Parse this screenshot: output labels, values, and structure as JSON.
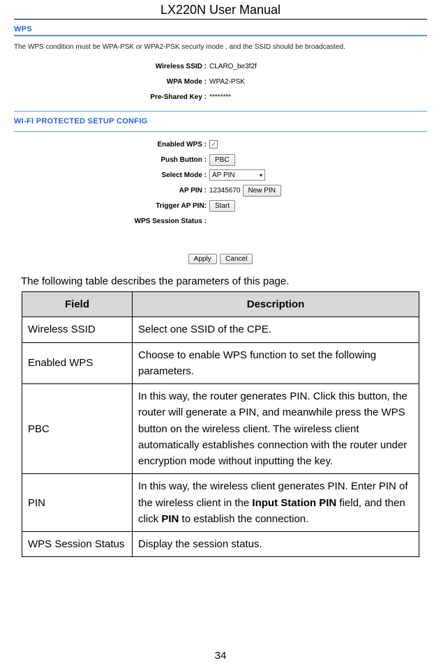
{
  "header": {
    "title": "LX220N User Manual"
  },
  "wps": {
    "section_title": "WPS",
    "condition": "The WPS condition must be WPA-PSK or WPA2-PSK securty mode , and the SSID should be broadcasted.",
    "fields": {
      "ssid_label": "Wireless SSID :",
      "ssid_value": "CLARO_be3f2f",
      "wpa_mode_label": "WPA Mode :",
      "wpa_mode_value": "WPA2-PSK",
      "psk_label": "Pre-Shared Key :",
      "psk_value": "********"
    }
  },
  "config": {
    "section_title": "WI-FI PROTECTED SETUP CONFIG",
    "enabled_label": "Enabled WPS :",
    "enabled_checked": "✓",
    "push_button_label": "Push Button :",
    "pbc_btn": "PBC",
    "select_mode_label": "Select Mode :",
    "select_mode_value": "AP PIN",
    "ap_pin_label": "AP PIN :",
    "ap_pin_value": "12345670",
    "new_pin_btn": "New PIN",
    "trigger_label": "Trigger AP PIN:",
    "start_btn": "Start",
    "session_label": "WPS Session Status :",
    "apply_btn": "Apply",
    "cancel_btn": "Cancel"
  },
  "table_intro": "The following table describes the parameters of this page.",
  "table_headers": {
    "field": "Field",
    "description": "Description"
  },
  "rows": [
    {
      "field": "Wireless SSID",
      "desc": "Select one SSID of the CPE."
    },
    {
      "field": "Enabled WPS",
      "desc": "Choose to enable WPS function to set the following parameters."
    },
    {
      "field": "PBC",
      "desc": "In this way, the router generates PIN. Click this button, the router will generate a PIN, and meanwhile press the WPS button on the wireless client. The wireless client automatically establishes connection with the router under encryption mode without inputting the key."
    },
    {
      "field": "PIN",
      "desc_prefix": "In this way, the wireless client generates PIN. Enter PIN of the wireless client in the ",
      "desc_bold1": "Input Station PIN",
      "desc_mid": " field, and then click ",
      "desc_bold2": "PIN",
      "desc_suffix": " to establish the connection."
    },
    {
      "field": "WPS Session Status",
      "desc": "Display the session status."
    }
  ],
  "page_number": "34"
}
